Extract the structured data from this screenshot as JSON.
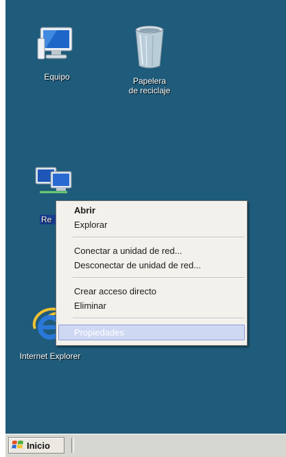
{
  "desktop": {
    "background_color": "#1f5b7a",
    "icons": [
      {
        "id": "equipo",
        "label": "Equipo",
        "icon": "computer-icon"
      },
      {
        "id": "papelera",
        "label": "Papelera de reciclaje",
        "icon": "recycle-bin-icon"
      },
      {
        "id": "red",
        "label": "Re",
        "icon": "network-icon"
      },
      {
        "id": "ie",
        "label": "Internet Explorer",
        "icon": "internet-explorer-icon"
      }
    ]
  },
  "context_menu": {
    "items": [
      {
        "label": "Abrir",
        "bold": true
      },
      {
        "label": "Explorar"
      },
      {
        "label": "Conectar a unidad de red..."
      },
      {
        "label": "Desconectar de unidad de red..."
      },
      {
        "label": "Crear acceso directo"
      },
      {
        "label": "Eliminar"
      },
      {
        "label": "Propiedades",
        "highlighted": true
      }
    ],
    "highlight_color": "#cfd8f3"
  },
  "taskbar": {
    "start_label": "Inicio",
    "start_icon": "windows-flag-icon"
  }
}
